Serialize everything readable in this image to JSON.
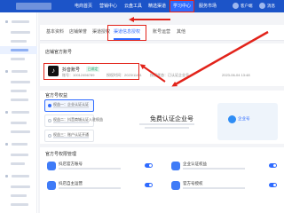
{
  "topbar": {
    "nav": [
      "电商首页",
      "营销中心",
      "云盘工具",
      "精选渠道",
      "学习中心",
      "服务市场"
    ],
    "right": [
      "客户端",
      "消息"
    ]
  },
  "tabs": [
    "基本资料",
    "店铺荣誉",
    "渠道授权",
    "渠道信息授权",
    "账号运营",
    "其他"
  ],
  "bound_section": {
    "title": "店铺官方账号",
    "account_name": "抖音账号",
    "badge": "已绑定",
    "meta": [
      "账号：10012456789",
      "授权时间：2023/11/01",
      "授权状态：已认证企业号",
      "2023-06-04 13:48"
    ]
  },
  "official_section": {
    "title": "官方号权益",
    "options": [
      "权益一：企业认证认证",
      "权益二：抖音商城认证入驻权益",
      "权益三：账户认证开通"
    ],
    "promo_title": "免费认证企业号",
    "app_name": "企业号"
  },
  "management_section": {
    "title": "官方号权限管理",
    "features": [
      "抖店官方账号",
      "企业认证权益",
      "抖店自主运营",
      "官方号授权"
    ]
  },
  "colors": {
    "brand": "#1c54c8",
    "accent": "#2f6bff",
    "highlight": "#e2231a"
  }
}
